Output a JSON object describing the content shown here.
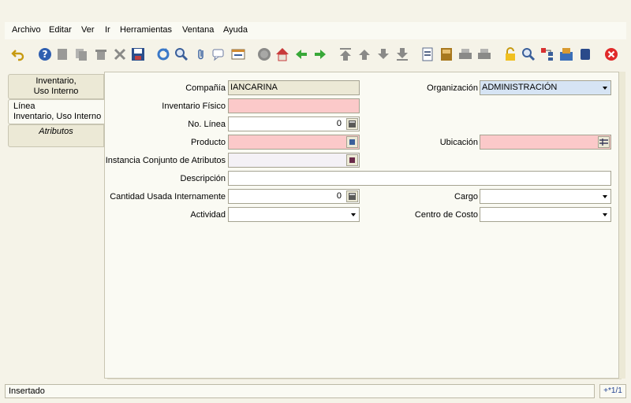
{
  "menu": [
    "Archivo",
    "Editar",
    "Ver",
    "Ir",
    "Herramientas",
    "Ventana",
    "Ayuda"
  ],
  "toolbar_icons": [
    "undo-icon",
    "help-icon",
    "new-record-icon",
    "copy-icon",
    "delete-icon",
    "delete-selection-icon",
    "save-icon",
    "refresh-icon",
    "find-icon",
    "attachment-icon",
    "chat-icon",
    "grid-toggle-icon",
    "history-icon",
    "home-icon",
    "back-icon",
    "forward-icon",
    "first-record-icon",
    "previous-record-icon",
    "next-record-icon",
    "last-record-icon",
    "report-icon",
    "archive-icon",
    "print-preview-icon",
    "print-icon",
    "lock-icon",
    "zoom-across-icon",
    "workflow-icon",
    "product-info-icon",
    "end-icon",
    "close-icon"
  ],
  "tabs": [
    {
      "line1": "Inventario,",
      "line2": "Uso Interno"
    },
    {
      "line1": "Línea",
      "line2": "Inventario, Uso Interno"
    },
    {
      "line1": "Atributos"
    }
  ],
  "form": {
    "compania_label": "Compañía",
    "compania_value": "IANCARINA",
    "organizacion_label": "Organización",
    "organizacion_value": "ADMINISTRACIÓN",
    "inventario_label": "Inventario Físico",
    "inventario_value": "",
    "linea_label": "No. Línea",
    "linea_value": "0",
    "producto_label": "Producto",
    "producto_value": "",
    "ubicacion_label": "Ubicación",
    "ubicacion_value": "",
    "instancia_label": "Instancia Conjunto de Atributos",
    "instancia_value": "",
    "descripcion_label": "Descripción",
    "descripcion_value": "",
    "cantidad_label": "Cantidad Usada Internamente",
    "cantidad_value": "0",
    "cargo_label": "Cargo",
    "cargo_value": "",
    "actividad_label": "Actividad",
    "actividad_value": "",
    "centro_label": "Centro de Costo",
    "centro_value": ""
  },
  "status": {
    "text": "Insertado",
    "record": "+*1/1"
  },
  "colors": {
    "mandatory": "#fbc9c9",
    "readonly": "#ece9d6",
    "selected": "#d6e4f4",
    "background": "#f5f3e8"
  }
}
